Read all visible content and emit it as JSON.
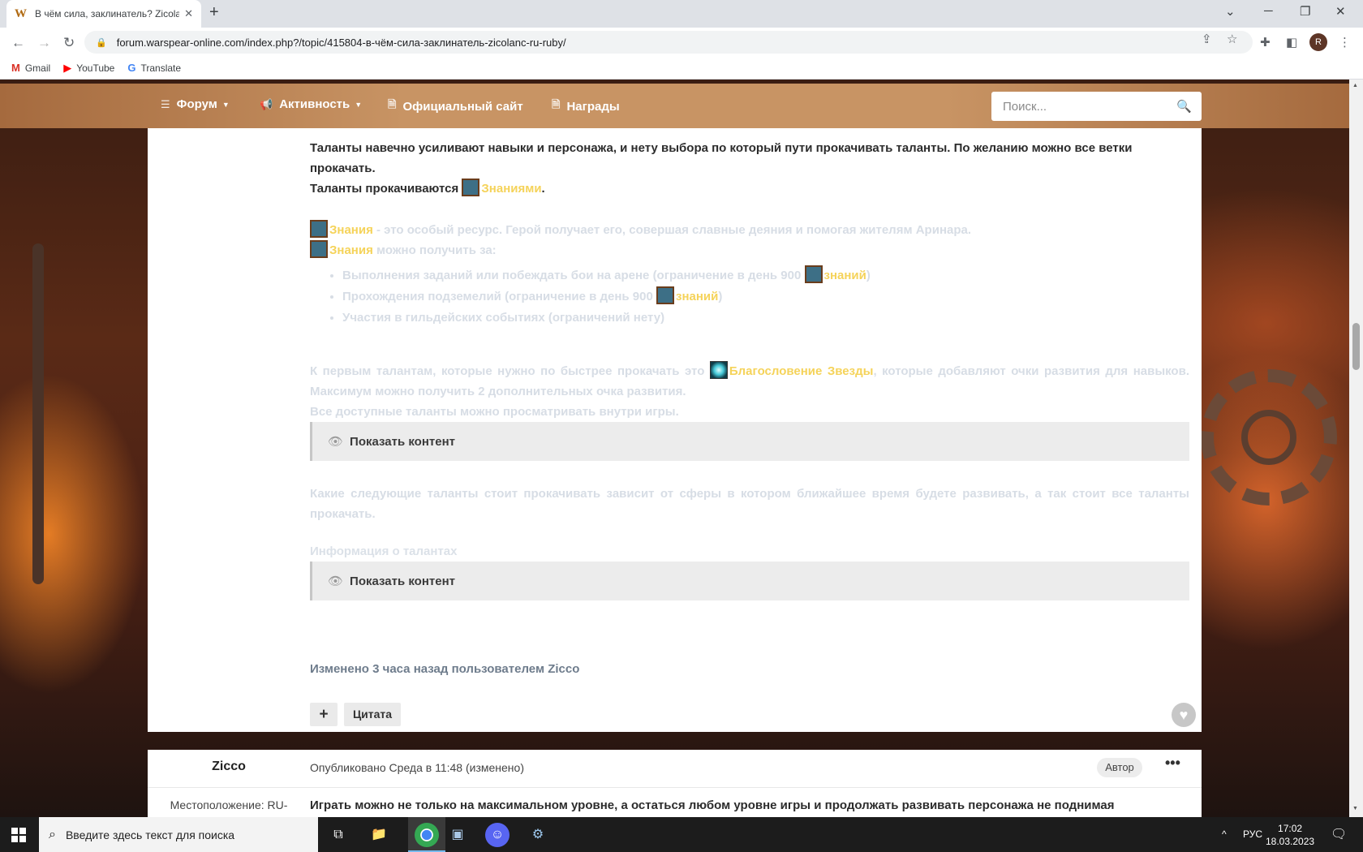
{
  "browser": {
    "tab_title": "В чём сила, заклинатель? Zicola",
    "favicon": "W",
    "url": "forum.warspear-online.com/index.php?/topic/415804-в-чём-сила-заклинатель-zicolanc-ru-ruby/",
    "avatar_letter": "R",
    "bookmarks": [
      "Gmail",
      "YouTube",
      "Translate"
    ]
  },
  "nav": {
    "items": [
      "Форум",
      "Активность",
      "Официальный сайт",
      "Награды"
    ],
    "search_placeholder": "Поиск..."
  },
  "post": {
    "p1": "Таланты навечно усиливают навыки и персонажа, и нету выбора по который пути прокачивать таланты. По желанию можно все ветки прокачать.",
    "p2_prefix": "Таланты прокачиваются ",
    "p2_link": "Знаниями",
    "p2_suffix": ".",
    "p3_link": "Знания",
    "p3_text": " - это особый ресурс. Герой получает его, совершая славные деяния и помогая жителям Аринара.",
    "p4_link": "Знания",
    "p4_text": " можно получить за:",
    "list": [
      {
        "text": "Выполнения заданий или побеждать бои на арене (ограничение в день 900 ",
        "link": "знаний",
        "suffix": ")"
      },
      {
        "text": "Прохождения подземелий (ограничение в день 900 ",
        "link": "знаний",
        "suffix": ")"
      },
      {
        "text": "Участия в гильдейских событиях (ограничений нету)",
        "link": "",
        "suffix": ""
      }
    ],
    "p5_prefix": "К первым талантам, которые нужно по быстрее прокачать это ",
    "p5_link": "Благословение Звезды",
    "p5_suffix": ", которые добавляют очки развития для навыков. Максимум можно получить 2 дополнительных очка развития.",
    "p6": "Все доступные таланты можно просматривать внутри игры.",
    "spoiler_label": "Показать контент",
    "p7": "Какие следующие таланты стоит прокачивать зависит от сферы в котором ближайшее время будете развивать, а так стоит все таланты прокачать.",
    "p8": "Информация о талантах",
    "edited": "Изменено 3 часа назад пользователем Ziccо",
    "plus_label": "+",
    "quote_label": "Цитата"
  },
  "next_post": {
    "author": "Ziccо",
    "published": "Опубликовано Среда в 11:48 (изменено)",
    "badge": "Автор",
    "more": "•••",
    "location": "Местоположение: RU-",
    "snippet": "Играть можно не только на максимальном уровне, а остаться любом уровне игры и продолжать развивать персонажа не поднимая"
  },
  "taskbar": {
    "search_placeholder": "Введите здесь текст для поиска",
    "lang": "РУС",
    "time": "17:02",
    "date": "18.03.2023"
  }
}
